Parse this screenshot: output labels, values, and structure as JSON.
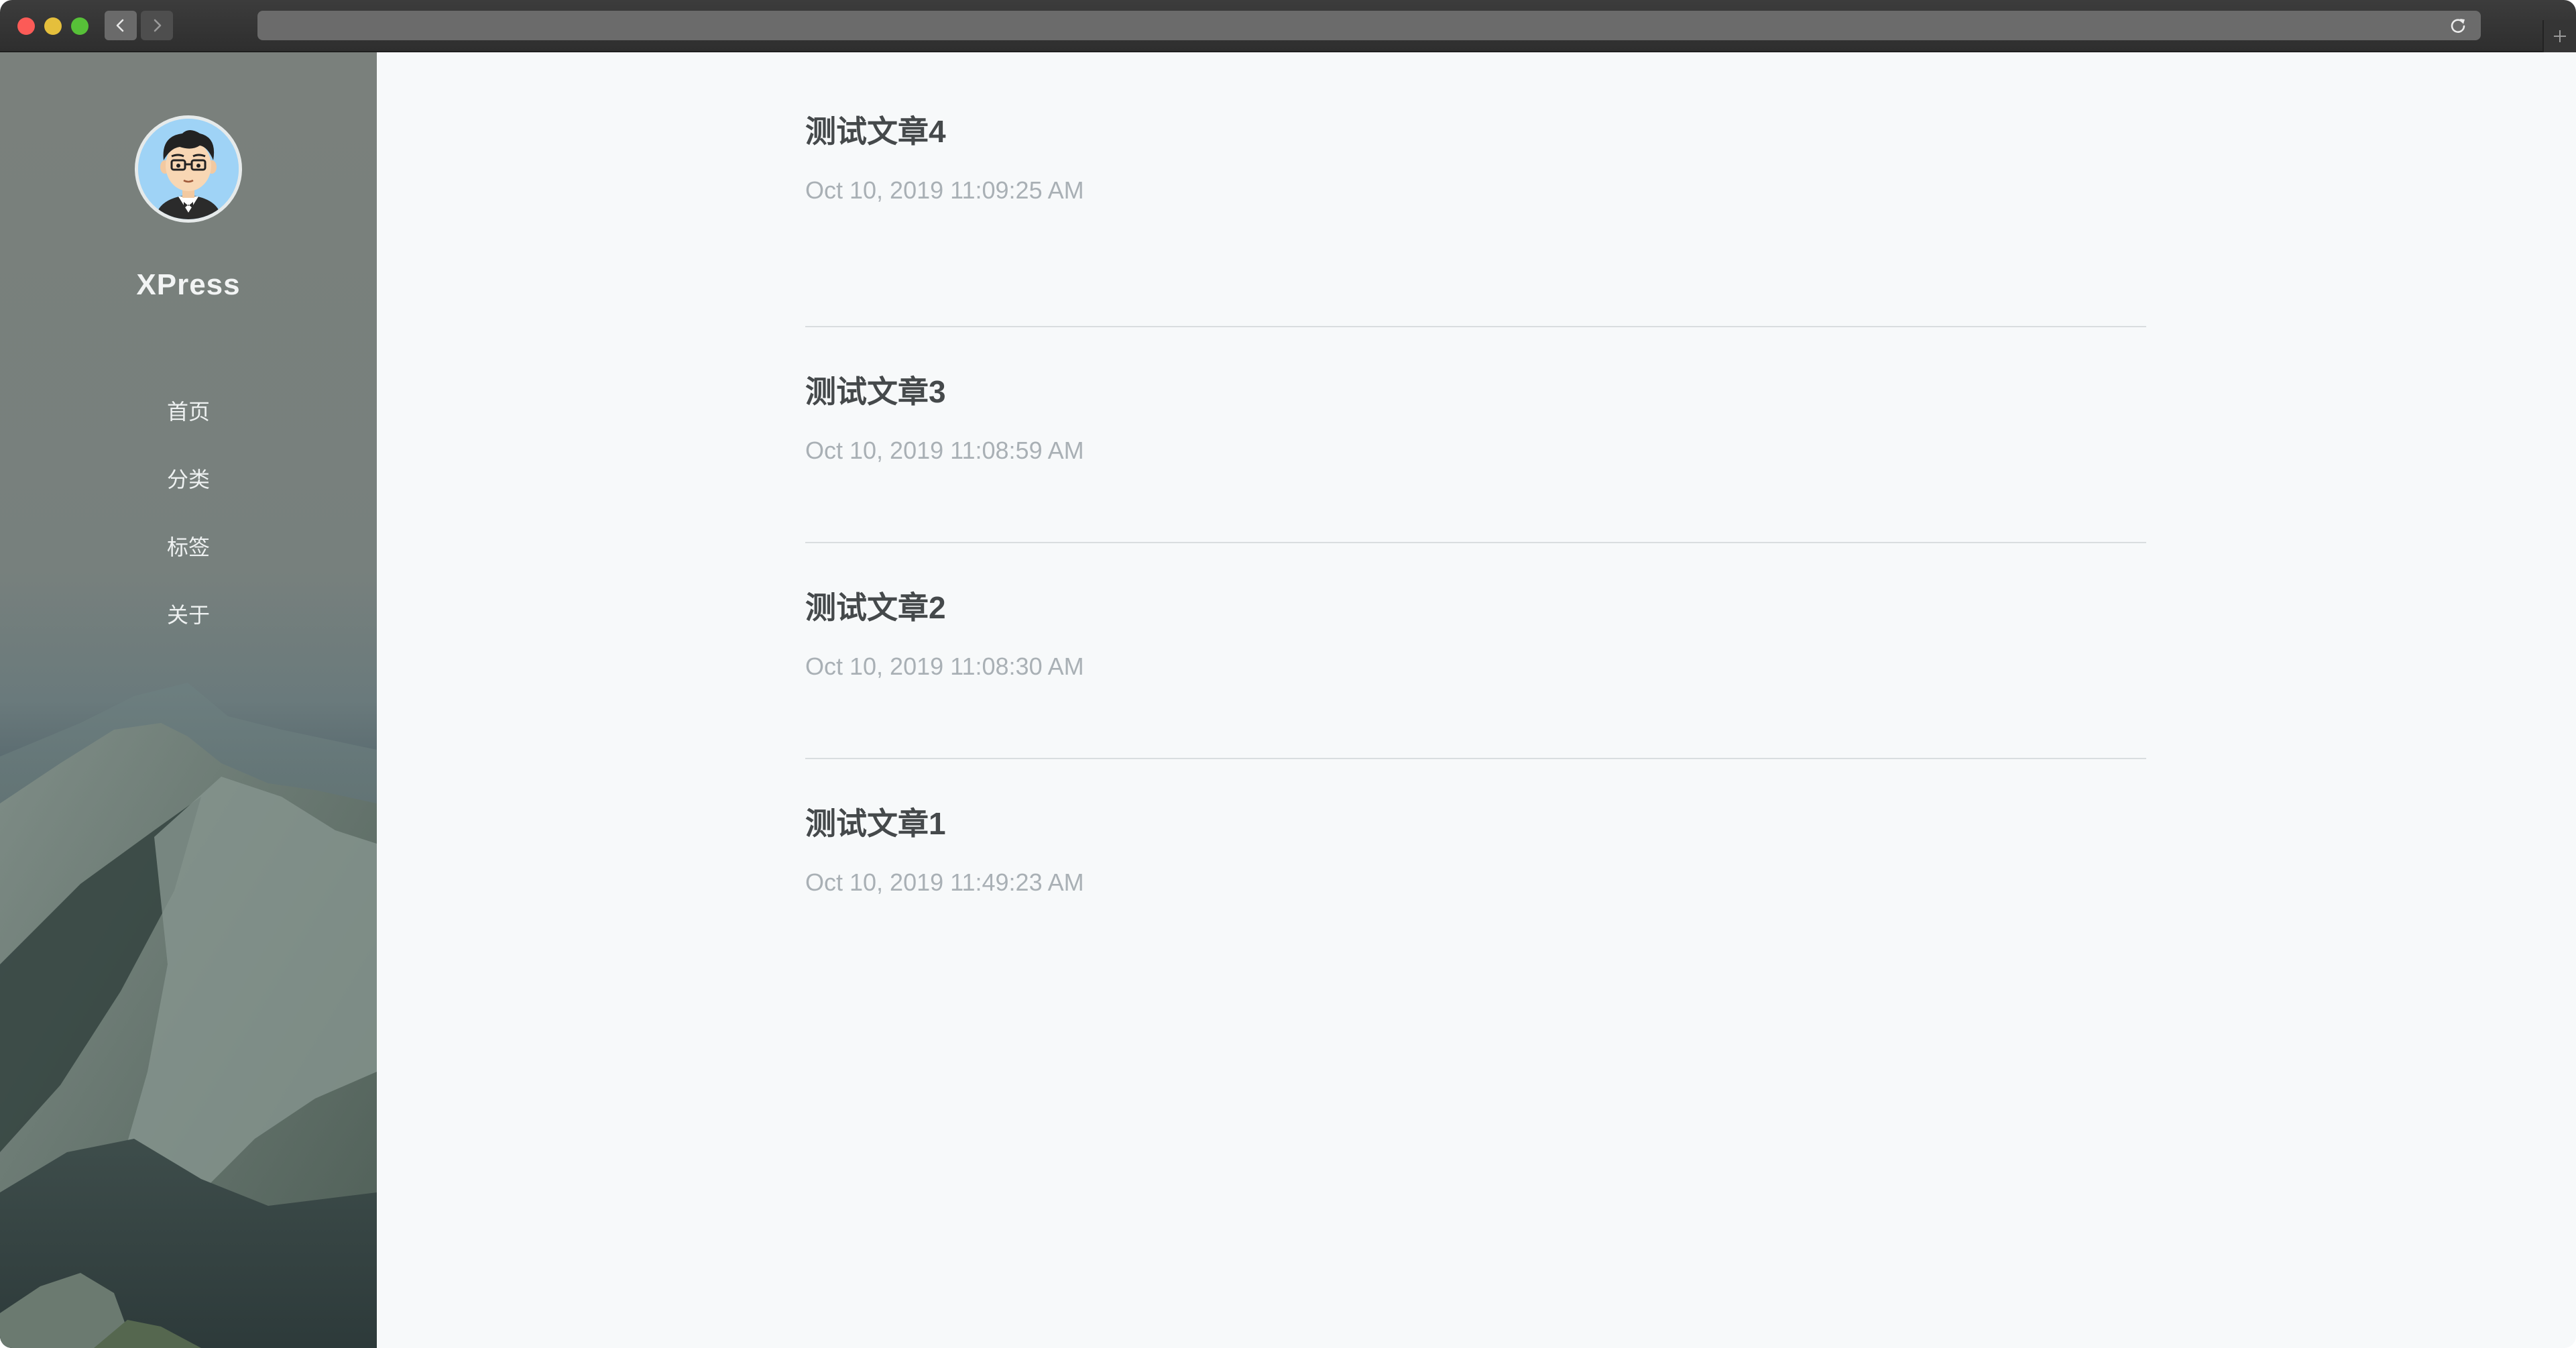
{
  "sidebar": {
    "site_title": "XPress",
    "menu": [
      {
        "label": "首页"
      },
      {
        "label": "分类"
      },
      {
        "label": "标签"
      },
      {
        "label": "关于"
      }
    ]
  },
  "posts": [
    {
      "title": "测试文章4",
      "date": "Oct 10, 2019 11:09:25 AM"
    },
    {
      "title": "测试文章3",
      "date": "Oct 10, 2019 11:08:59 AM"
    },
    {
      "title": "测试文章2",
      "date": "Oct 10, 2019 11:08:30 AM"
    },
    {
      "title": "测试文章1",
      "date": "Oct 10, 2019 11:49:23 AM"
    }
  ],
  "colors": {
    "sidebar_text": "#eef1f1",
    "post_title": "#45494b",
    "post_date": "#a9b0b5",
    "divider": "#d9dddf",
    "page_bg": "#f7f9fa"
  },
  "icons": {
    "back": "chevron-left-icon",
    "forward": "chevron-right-icon",
    "reload": "reload-icon",
    "new_tab": "plus-icon"
  }
}
